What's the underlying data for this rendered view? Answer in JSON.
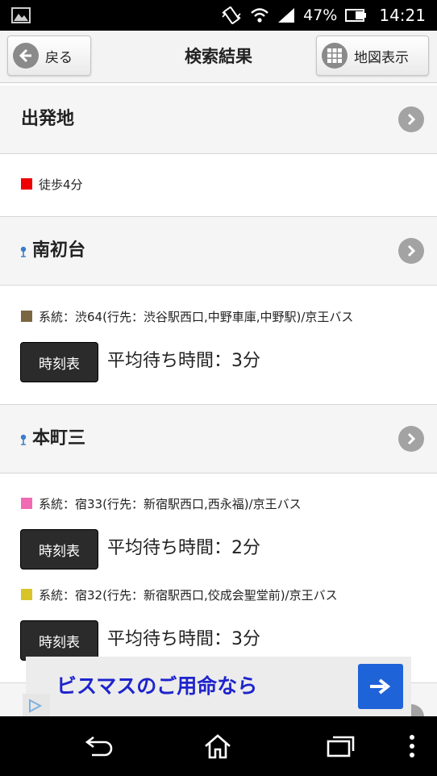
{
  "status_bar": {
    "battery": "47%",
    "time": "14:21"
  },
  "header": {
    "back_label": "戻る",
    "title": "検索結果",
    "map_label": "地図表示"
  },
  "origin": {
    "label": "出発地",
    "walk": "徒歩4分"
  },
  "stops": [
    {
      "name": "南初台",
      "routes": [
        {
          "color": "#7a6642",
          "text": "系統：渋64(行先：渋谷駅西口,中野車庫,中野駅)/京王バス",
          "timetable": "時刻表",
          "wait": "平均待ち時間：3分"
        }
      ]
    },
    {
      "name": "本町三",
      "routes": [
        {
          "color": "#f06ab4",
          "text": "系統：宿33(行先：新宿駅西口,西永福)/京王バス",
          "timetable": "時刻表",
          "wait": "平均待ち時間：2分"
        },
        {
          "color": "#d8c428",
          "text": "系統：宿32(行先：新宿駅西口,佼成会聖堂前)/京王バス",
          "timetable": "時刻表",
          "wait": "平均待ち時間：3分"
        }
      ]
    }
  ],
  "walk_color": "#ee0000",
  "ad": {
    "text": "ビスマスのご用命なら"
  },
  "icons": {
    "status": [
      "image-icon",
      "vibrate-icon",
      "wifi-icon",
      "signal-icon",
      "battery-icon"
    ],
    "nav": [
      "back-nav-icon",
      "home-icon",
      "recents-icon",
      "overflow-menu-icon"
    ]
  }
}
